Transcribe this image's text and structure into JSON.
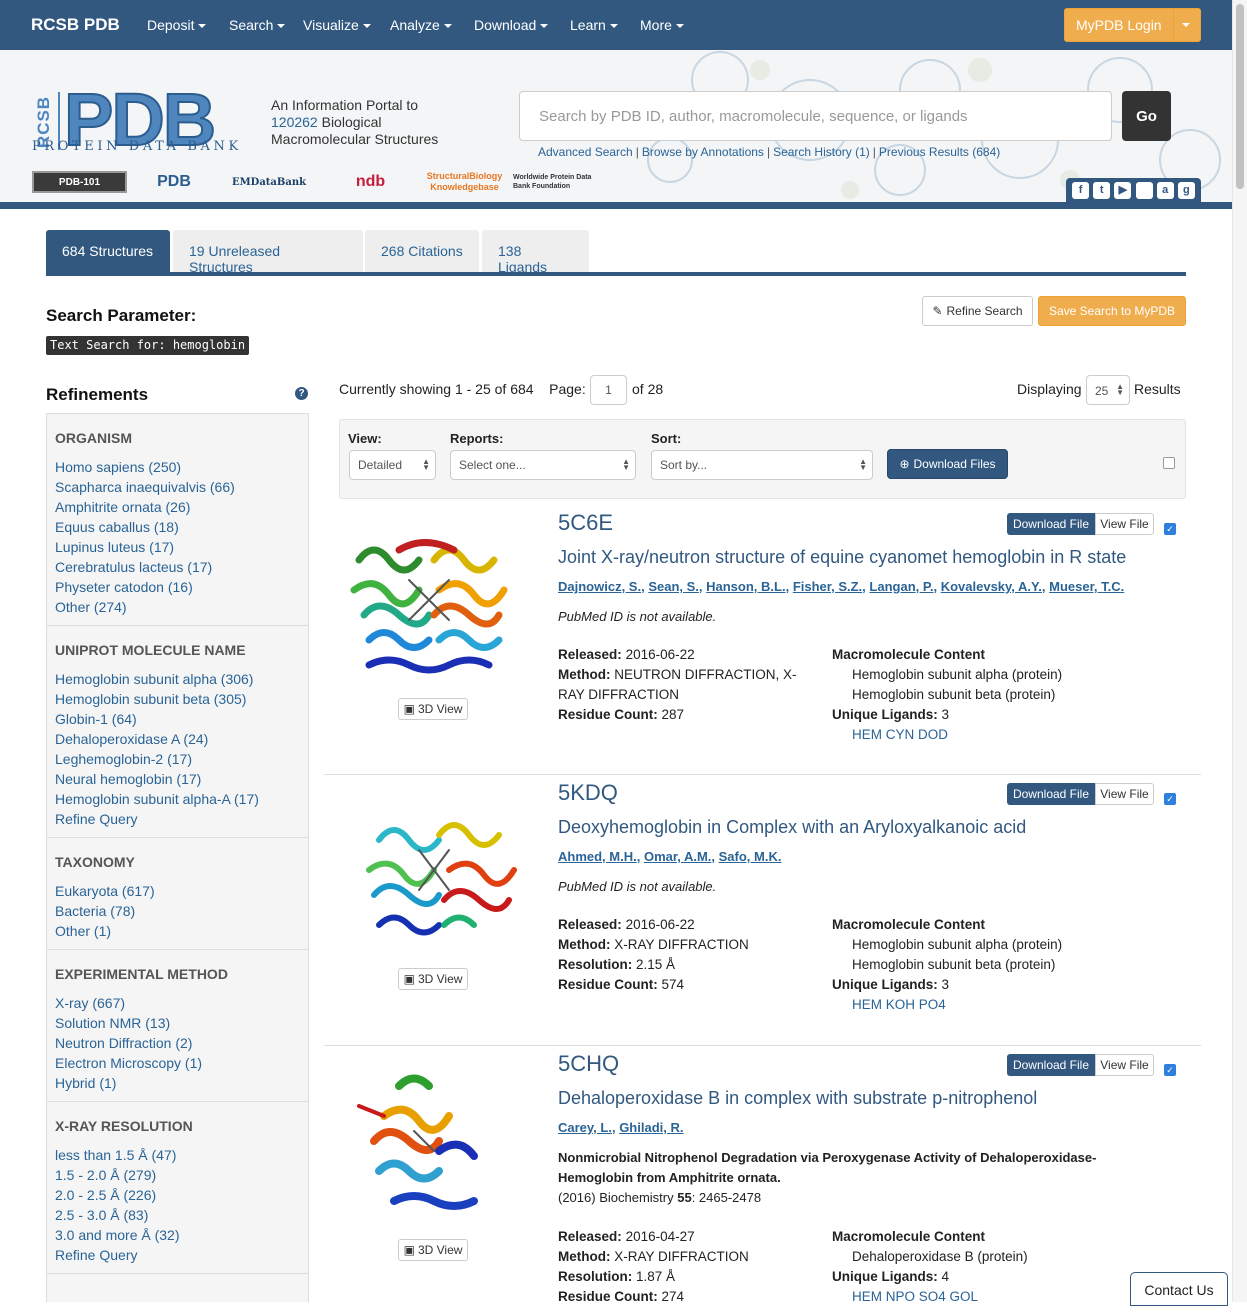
{
  "nav": {
    "brand": "RCSB PDB",
    "items": [
      "Deposit",
      "Search",
      "Visualize",
      "Analyze",
      "Download",
      "Learn",
      "More"
    ],
    "login": "MyPDB Login"
  },
  "header": {
    "logo_rcsb": "RCSB",
    "logo_pdb": "PDB",
    "logo_sub": "PROTEIN DATA BANK",
    "tagline_1": "An Information Portal to",
    "tagline_count": "120262",
    "tagline_2": " Biological",
    "tagline_3": "Macromolecular Structures",
    "partners": [
      "PDB-101",
      "PDB",
      "EMDataBank",
      "ndb",
      "StructuralBiology Knowledgebase",
      "Worldwide Protein Data Bank Foundation"
    ],
    "search_placeholder": "Search by PDB ID, author, macromolecule, sequence, or ligands",
    "go": "Go",
    "links": [
      "Advanced Search",
      "Browse by Annotations",
      "Search History (1)",
      "Previous Results (684)"
    ],
    "social_icons": [
      "facebook-icon",
      "twitter-icon",
      "youtube-icon",
      "apple-icon",
      "android-icon",
      "github-icon"
    ]
  },
  "tabs": [
    "684 Structures",
    "19 Unreleased Structures",
    "268 Citations",
    "138 Ligands"
  ],
  "search_param": {
    "title": "Search Parameter:",
    "query": "Text Search for: hemoglobin",
    "refine": "Refine Search",
    "save": "Save Search to MyPDB"
  },
  "refinements": {
    "title": "Refinements",
    "groups": [
      {
        "title": "ORGANISM",
        "items": [
          "Homo sapiens (250)",
          "Scapharca inaequivalvis (66)",
          "Amphitrite ornata (26)",
          "Equus caballus (18)",
          "Lupinus luteus (17)",
          "Cerebratulus lacteus (17)",
          "Physeter catodon (16)",
          "Other (274)"
        ]
      },
      {
        "title": "UNIPROT MOLECULE NAME",
        "items": [
          "Hemoglobin subunit alpha (306)",
          "Hemoglobin subunit beta (305)",
          "Globin-1 (64)",
          "Dehaloperoxidase A (24)",
          "Leghemoglobin-2 (17)",
          "Neural hemoglobin (17)",
          "Hemoglobin subunit alpha-A (17)",
          "Refine Query"
        ]
      },
      {
        "title": "TAXONOMY",
        "items": [
          "Eukaryota (617)",
          "Bacteria (78)",
          "Other (1)"
        ]
      },
      {
        "title": "EXPERIMENTAL METHOD",
        "items": [
          "X-ray (667)",
          "Solution NMR (13)",
          "Neutron Diffraction (2)",
          "Electron Microscopy (1)",
          "Hybrid (1)"
        ]
      },
      {
        "title": "X-RAY RESOLUTION",
        "items": [
          "less than 1.5 Å (47)",
          "1.5 - 2.0 Å (279)",
          "2.0 - 2.5 Å (226)",
          "2.5 - 3.0 Å (83)",
          "3.0 and more Å (32)",
          "Refine Query"
        ]
      }
    ]
  },
  "paging": {
    "showing": "Currently showing 1 - 25 of 684",
    "page_label": "Page:",
    "page": "1",
    "of": "of 28",
    "displaying": "Displaying",
    "per_page": "25",
    "results": "Results"
  },
  "controls": {
    "view_label": "View:",
    "view_value": "Detailed",
    "reports_label": "Reports:",
    "reports_value": "Select one...",
    "sort_label": "Sort:",
    "sort_value": "Sort by...",
    "download": "Download Files"
  },
  "results": [
    {
      "id": "5C6E",
      "title": "Joint X-ray/neutron structure of equine cyanomet hemoglobin in R state",
      "authors": [
        "Dajnowicz, S.",
        "Sean, S.",
        "Hanson, B.L.",
        "Fisher, S.Z.",
        "Langan, P.",
        "Kovalevsky, A.Y.",
        "Mueser, T.C."
      ],
      "pubmed": "PubMed ID is not available.",
      "released": "2016-06-22",
      "method": "NEUTRON DIFFRACTION, X-RAY DIFFRACTION",
      "residue_count": "287",
      "macromolecules": [
        "Hemoglobin subunit alpha (protein)",
        "Hemoglobin subunit beta (protein)"
      ],
      "unique_ligands": "3",
      "ligands": "HEM CYN DOD"
    },
    {
      "id": "5KDQ",
      "title": "Deoxyhemoglobin in Complex with an Aryloxyalkanoic acid",
      "authors": [
        "Ahmed, M.H.",
        "Omar, A.M.",
        "Safo, M.K."
      ],
      "pubmed": "PubMed ID is not available.",
      "released": "2016-06-22",
      "method": "X-RAY DIFFRACTION",
      "resolution": "2.15 Å",
      "residue_count": "574",
      "macromolecules": [
        "Hemoglobin subunit alpha (protein)",
        "Hemoglobin subunit beta (protein)"
      ],
      "unique_ligands": "3",
      "ligands": "HEM KOH PO4"
    },
    {
      "id": "5CHQ",
      "title": "Dehaloperoxidase B in complex with substrate p-nitrophenol",
      "authors": [
        "Carey, L.",
        "Ghiladi, R."
      ],
      "citation_title": "Nonmicrobial Nitrophenol Degradation via Peroxygenase Activity of Dehaloperoxidase-Hemoglobin from Amphitrite ornata.",
      "citation_journal": "(2016) Biochemistry ",
      "citation_volume": "55",
      "citation_pages": ": 2465-2478",
      "released": "2016-04-27",
      "method": "X-RAY DIFFRACTION",
      "resolution": "1.87 Å",
      "residue_count": "274",
      "macromolecules": [
        "Dehaloperoxidase B (protein)"
      ],
      "unique_ligands": "4",
      "ligands": "HEM NPO SO4 GOL"
    }
  ],
  "labels": {
    "released": "Released:",
    "method": "Method:",
    "resolution": "Resolution:",
    "residue_count": "Residue Count:",
    "macromolecule_content": "Macromolecule Content",
    "unique_ligands": "Unique Ligands:",
    "download_file": "Download File",
    "view_file": "View File",
    "view3d": "3D View"
  },
  "contact": "Contact Us"
}
